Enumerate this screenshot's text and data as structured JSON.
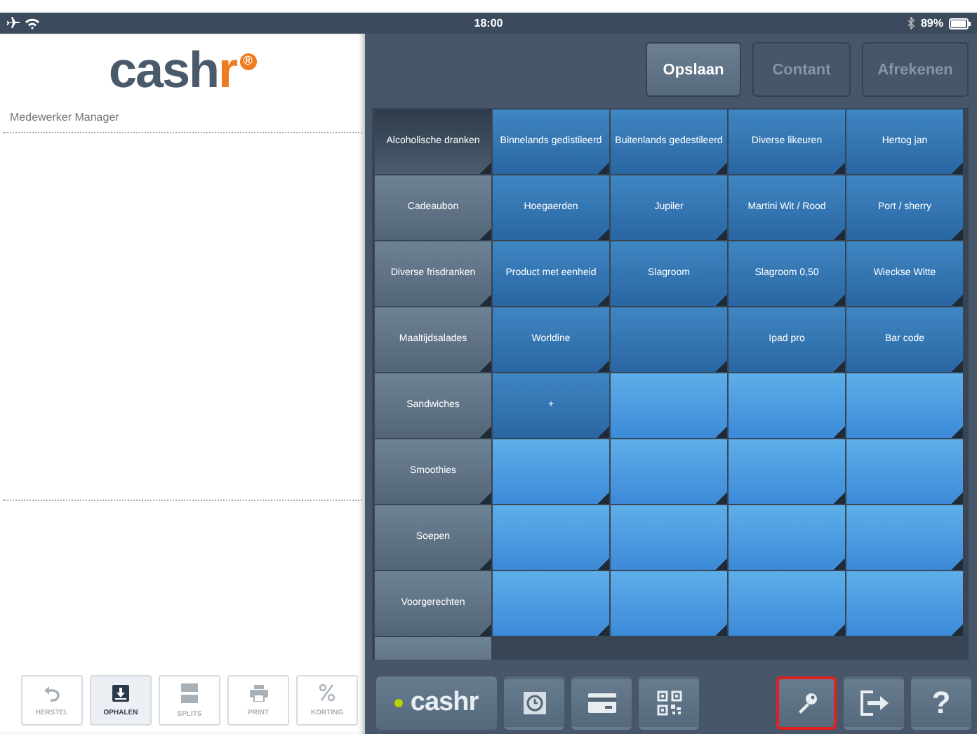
{
  "status_bar": {
    "time": "18:00",
    "battery": "89%"
  },
  "left_panel": {
    "logo": {
      "main": "cash",
      "accent": "r",
      "mark": "®"
    },
    "employee": "Medewerker Manager",
    "actions": [
      {
        "kind": "undo",
        "label": "HERSTEL",
        "selected": false
      },
      {
        "kind": "download",
        "label": "OPHALEN",
        "selected": true
      },
      {
        "kind": "split",
        "label": "SPLITS",
        "selected": false
      },
      {
        "kind": "print",
        "label": "PRINT",
        "selected": false
      },
      {
        "kind": "percent",
        "label": "KORTING",
        "selected": false
      }
    ]
  },
  "top_buttons": [
    {
      "label": "Opslaan",
      "disabled": false
    },
    {
      "label": "Contant",
      "disabled": true
    },
    {
      "label": "Afrekenen",
      "disabled": true
    }
  ],
  "categories": [
    {
      "label": "Alcoholische dranken",
      "selected": true
    },
    {
      "label": "Cadeaubon",
      "selected": false
    },
    {
      "label": "Diverse frisdranken",
      "selected": false
    },
    {
      "label": "Maaltijdsalades",
      "selected": false
    },
    {
      "label": "Sandwiches",
      "selected": false
    },
    {
      "label": "Smoothies",
      "selected": false
    },
    {
      "label": "Soepen",
      "selected": false
    },
    {
      "label": "Voorgerechten",
      "selected": false
    },
    {
      "selected": false
    }
  ],
  "products": [
    [
      {
        "kind": "product",
        "label": "Binnelands gedistileerd"
      },
      {
        "kind": "product",
        "label": "Buitenlands gedestileerd"
      },
      {
        "kind": "product",
        "label": "Diverse likeuren"
      },
      {
        "kind": "product",
        "label": "Hertog jan"
      }
    ],
    [
      {
        "kind": "product",
        "label": "Hoegaerden"
      },
      {
        "kind": "product",
        "label": "Jupiler"
      },
      {
        "kind": "product",
        "label": "Martini Wit / Rood"
      },
      {
        "kind": "product",
        "label": "Port / sherry"
      }
    ],
    [
      {
        "kind": "product",
        "label": "Product met eenheid"
      },
      {
        "kind": "product",
        "label": "Slagroom"
      },
      {
        "kind": "product",
        "label": "Slagroom 0,50"
      },
      {
        "kind": "product",
        "label": "Wieckse Witte"
      }
    ],
    [
      {
        "kind": "product",
        "label": "Worldine"
      },
      {
        "kind": "product"
      },
      {
        "kind": "product",
        "label": "Ipad pro"
      },
      {
        "kind": "product",
        "label": "Bar code"
      }
    ],
    [
      {
        "kind": "product",
        "label": "+"
      },
      {
        "kind": "empty"
      },
      {
        "kind": "empty"
      },
      {
        "kind": "empty"
      }
    ],
    [
      {
        "kind": "empty"
      },
      {
        "kind": "empty"
      },
      {
        "kind": "empty"
      },
      {
        "kind": "empty"
      }
    ],
    [
      {
        "kind": "empty"
      },
      {
        "kind": "empty"
      },
      {
        "kind": "empty"
      },
      {
        "kind": "empty"
      }
    ],
    [
      {
        "kind": "empty"
      },
      {
        "kind": "empty"
      },
      {
        "kind": "empty"
      },
      {
        "kind": "empty"
      }
    ]
  ],
  "toolbar": {
    "brand": "cashr",
    "online": true,
    "buttons": [
      {
        "kind": "clock",
        "selected": false
      },
      {
        "kind": "card",
        "selected": false
      },
      {
        "kind": "qr",
        "selected": false
      },
      {
        "kind": "key",
        "selected": true
      },
      {
        "kind": "exit",
        "selected": false
      },
      {
        "kind": "help",
        "label": "?",
        "selected": false
      }
    ]
  }
}
